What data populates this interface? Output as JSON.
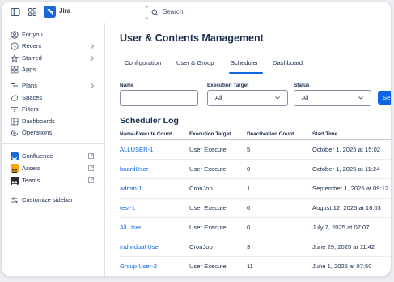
{
  "topbar": {
    "app_name": "Jira",
    "search_placeholder": "Search"
  },
  "sidebar": {
    "items": [
      {
        "label": "For you",
        "icon": "user-circle-icon"
      },
      {
        "label": "Recent",
        "icon": "clock-icon"
      },
      {
        "label": "Starred",
        "icon": "star-icon"
      },
      {
        "label": "Apps",
        "icon": "apps-icon"
      },
      {
        "label": "Plans",
        "icon": "plans-icon"
      },
      {
        "label": "Spaces",
        "icon": "spaces-icon"
      },
      {
        "label": "Filters",
        "icon": "filter-icon"
      },
      {
        "label": "Dashboards",
        "icon": "dashboard-icon"
      },
      {
        "label": "Operations",
        "icon": "operations-icon"
      }
    ],
    "apps": [
      {
        "label": "Confluence",
        "icon": "confluence-icon",
        "color": "#1868db"
      },
      {
        "label": "Assets",
        "icon": "assets-icon",
        "color": "#fca700"
      },
      {
        "label": "Teams",
        "icon": "teams-icon",
        "color": "#292a2e"
      }
    ],
    "customize": {
      "label": "Customize sidebar",
      "icon": "customize-icon"
    }
  },
  "main": {
    "title": "User & Contents Management",
    "tabs": [
      "Configuration",
      "User & Group",
      "Scheduler",
      "Dashboard"
    ],
    "active_tab": "Scheduler",
    "filters": {
      "name_label": "Name",
      "name_value": "",
      "target_label": "Execution Target",
      "target_value": "All",
      "status_label": "Status",
      "status_value": "All",
      "search_button": "Se"
    },
    "log": {
      "title": "Scheduler Log",
      "columns": [
        "Name-Execute Count",
        "Execution Target",
        "Deactivation Count",
        "Start Time"
      ],
      "rows": [
        {
          "name": "ALLUSER-1",
          "target": "User Execute",
          "count": "5",
          "start": "October 1, 2025 at 15:02"
        },
        {
          "name": "boardUser",
          "target": "User Execute",
          "count": "0",
          "start": "October 1, 2025 at 11:24"
        },
        {
          "name": "admin-1",
          "target": "CronJob",
          "count": "1",
          "start": "September 1, 2025 at 09:12"
        },
        {
          "name": "test-1",
          "target": "User Execute",
          "count": "0",
          "start": "August 12, 2025 at 16:03"
        },
        {
          "name": "All User",
          "target": "User Execute",
          "count": "0",
          "start": "July 7, 2025 at 07:07"
        },
        {
          "name": "Individual User",
          "target": "CronJob",
          "count": "3",
          "start": "June 29, 2025 at 11:42"
        },
        {
          "name": "Group User-2",
          "target": "User Execute",
          "count": "11",
          "start": "June 1, 2025 at 07:50"
        }
      ]
    }
  },
  "colors": {
    "accent": "#0c66e4",
    "jira_logo": "#1868db",
    "text": "#172b4d"
  }
}
